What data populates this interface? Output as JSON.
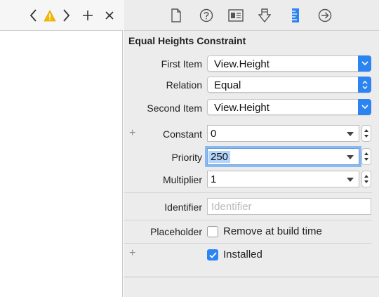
{
  "toolbar": {
    "left_icons": [
      "chevron-left-icon",
      "warning-icon",
      "chevron-right-icon",
      "plus-icon",
      "close-icon"
    ],
    "inspector_tabs": [
      "file-icon",
      "help-icon",
      "identity-icon",
      "attributes-icon",
      "size-ruler-icon",
      "connections-icon"
    ],
    "active_tab": "size-ruler-icon",
    "warning_color": "#f5b800"
  },
  "inspector": {
    "title": "Equal Heights Constraint",
    "first_item": {
      "label": "First Item",
      "value": "View.Height"
    },
    "relation": {
      "label": "Relation",
      "value": "Equal"
    },
    "second_item": {
      "label": "Second Item",
      "value": "View.Height"
    },
    "constant": {
      "label": "Constant",
      "value": "0"
    },
    "priority": {
      "label": "Priority",
      "value": "250"
    },
    "multiplier": {
      "label": "Multiplier",
      "value": "1"
    },
    "identifier": {
      "label": "Identifier",
      "placeholder": "Identifier"
    },
    "placeholder": {
      "label": "Placeholder",
      "checkbox_label": "Remove at build time",
      "checked": false
    },
    "installed": {
      "checkbox_label": "Installed",
      "checked": true
    },
    "plus_symbol": "+",
    "accent_color": "#2b84f2"
  }
}
